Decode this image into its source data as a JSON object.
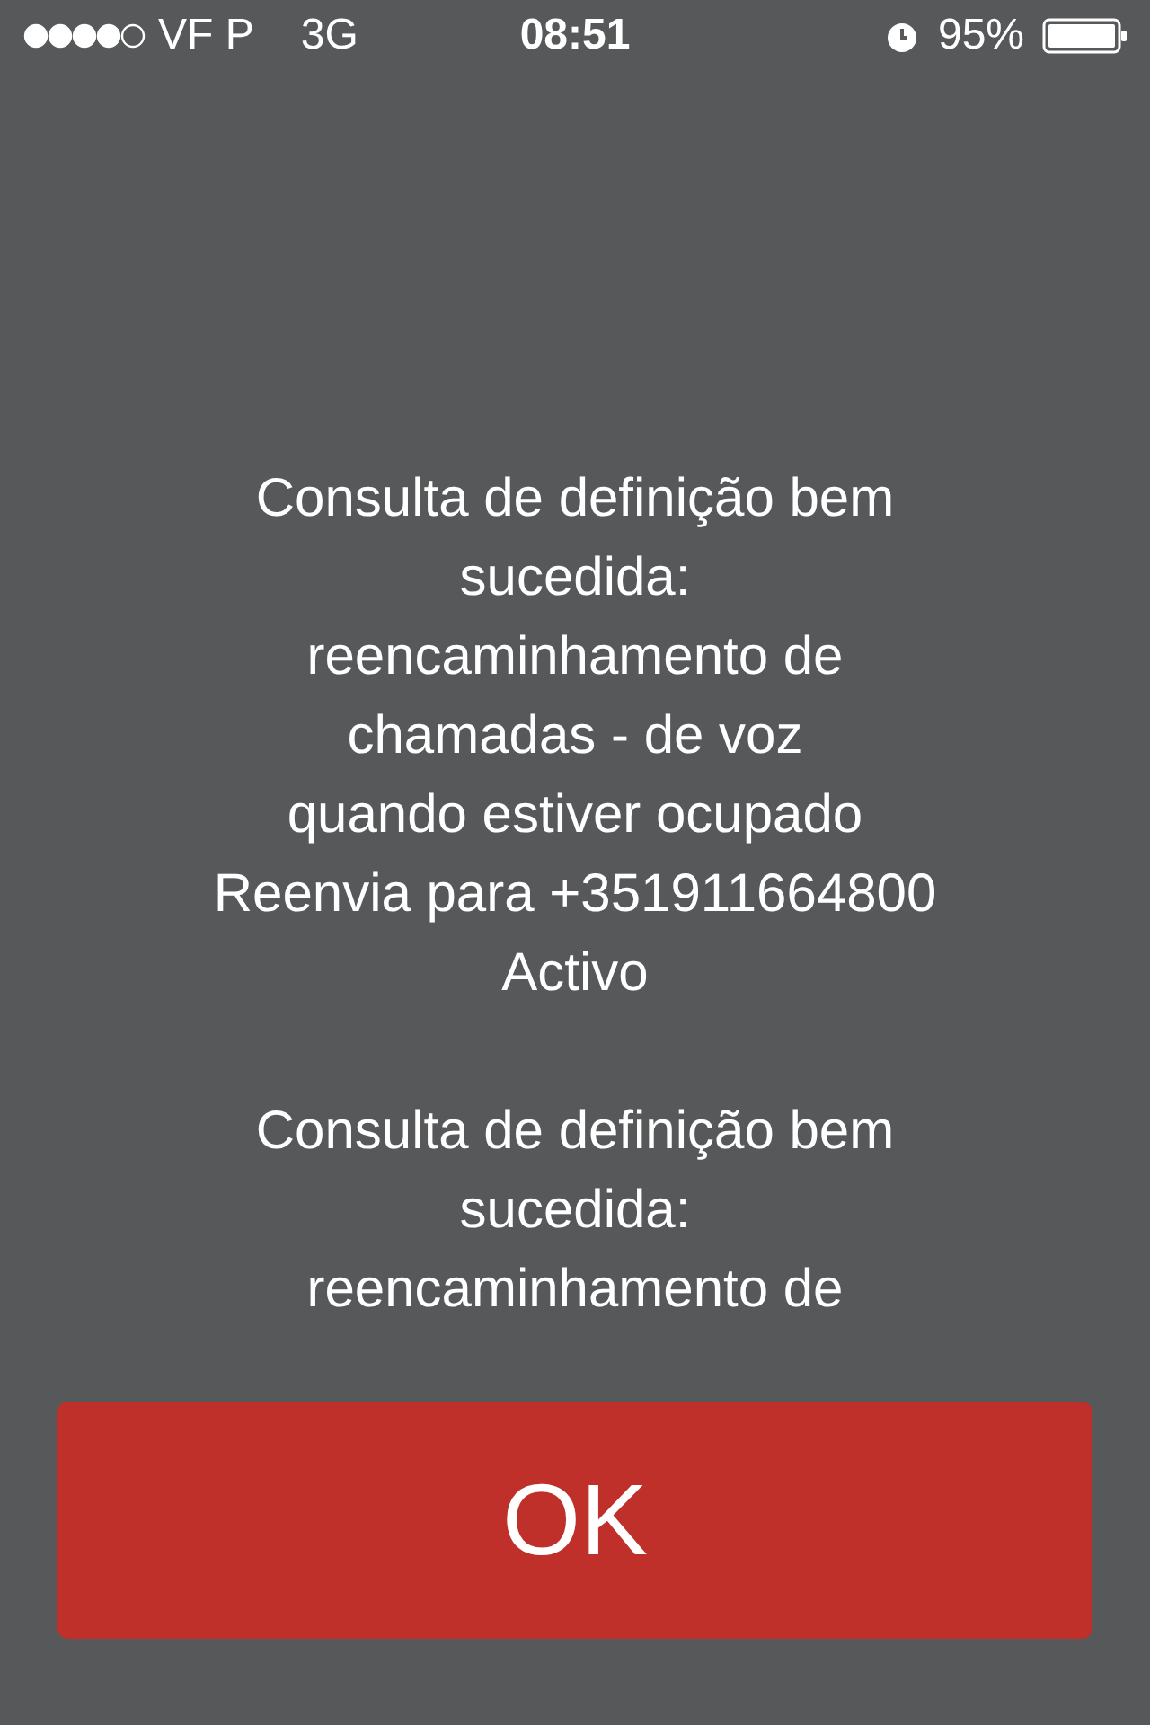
{
  "status_bar": {
    "carrier": "VF P",
    "network": "3G",
    "time": "08:51",
    "battery": "95%"
  },
  "message": {
    "paragraphs": [
      [
        "Consulta de definição bem",
        "sucedida:",
        "reencaminhamento de",
        "chamadas - de voz",
        "quando estiver ocupado",
        "Reenvia para +351911664800",
        "Activo"
      ],
      [
        "Consulta de definição bem",
        "sucedida:",
        "reencaminhamento de"
      ]
    ]
  },
  "button": {
    "label": "OK"
  }
}
